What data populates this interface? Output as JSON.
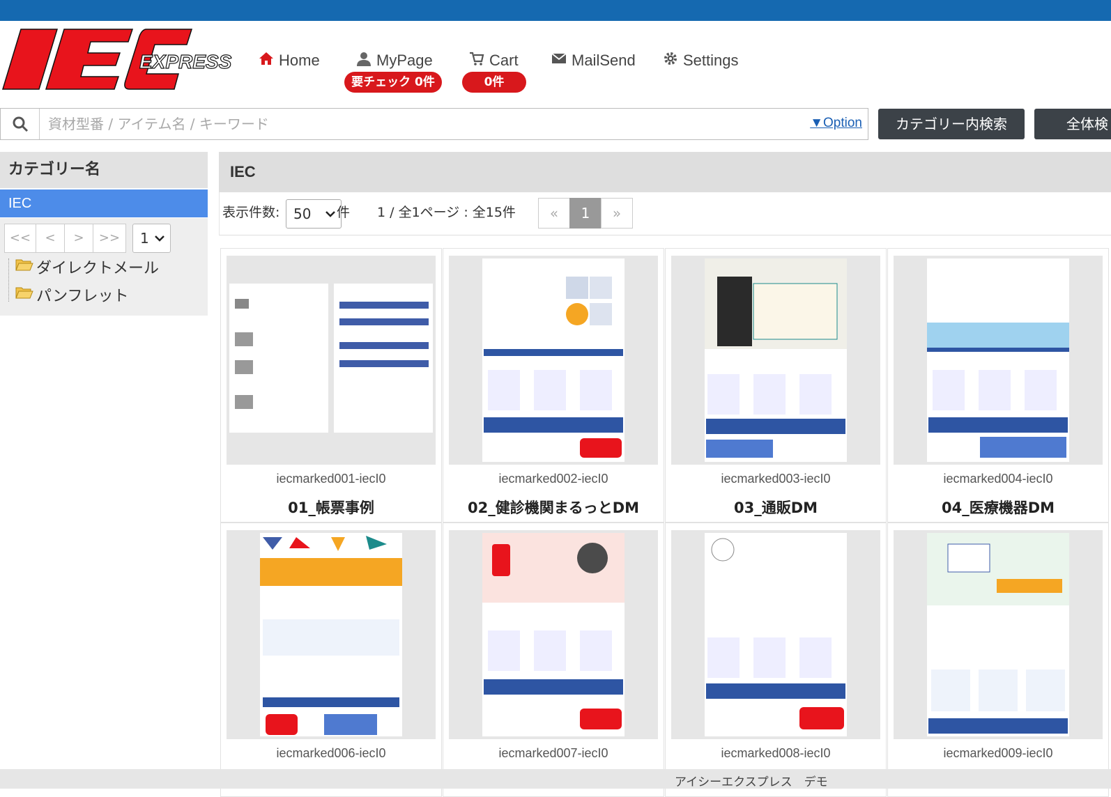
{
  "brand": {
    "logo_main": "IEC",
    "logo_sub": "EXPRESS",
    "color_red": "#e8141c",
    "color_blue": "#1569b0"
  },
  "nav": {
    "home": "Home",
    "mypage": "MyPage",
    "mypage_badge": "要チェック 0件",
    "cart": "Cart",
    "cart_badge": "0件",
    "mailsend": "MailSend",
    "settings": "Settings"
  },
  "search": {
    "placeholder": "資材型番 / アイテム名 / キーワード",
    "option_link": "▼Option",
    "category_search_button": "カテゴリー内検索",
    "all_search_button": "全体検"
  },
  "sidebar": {
    "header": "カテゴリー名",
    "active_category": "IEC",
    "pager": {
      "first": "<<",
      "prev": "<",
      "next": ">",
      "last": ">>",
      "page_select": "1"
    },
    "folders": [
      "ダイレクトメール",
      "パンフレット"
    ]
  },
  "main": {
    "title": "IEC",
    "per_page_label": "表示件数:",
    "per_page_value": "50",
    "per_page_unit": "件",
    "page_info": "1 / 全1ページ : 全15件",
    "pagination": {
      "prev": "«",
      "current": "1",
      "next": "»"
    }
  },
  "items": [
    {
      "code": "iecmarked001-iecI0",
      "title": "01_帳票事例"
    },
    {
      "code": "iecmarked002-iecI0",
      "title": "02_健診機関まるっとDM"
    },
    {
      "code": "iecmarked003-iecI0",
      "title": "03_通販DM"
    },
    {
      "code": "iecmarked004-iecI0",
      "title": "04_医療機器DM"
    },
    {
      "code": "iecmarked006-iecI0",
      "title": ""
    },
    {
      "code": "iecmarked007-iecI0",
      "title": ""
    },
    {
      "code": "iecmarked008-iecI0",
      "title": ""
    },
    {
      "code": "iecmarked009-iecI0",
      "title": ""
    }
  ],
  "footer": {
    "text": "アイシーエクスプレス　デモ"
  }
}
